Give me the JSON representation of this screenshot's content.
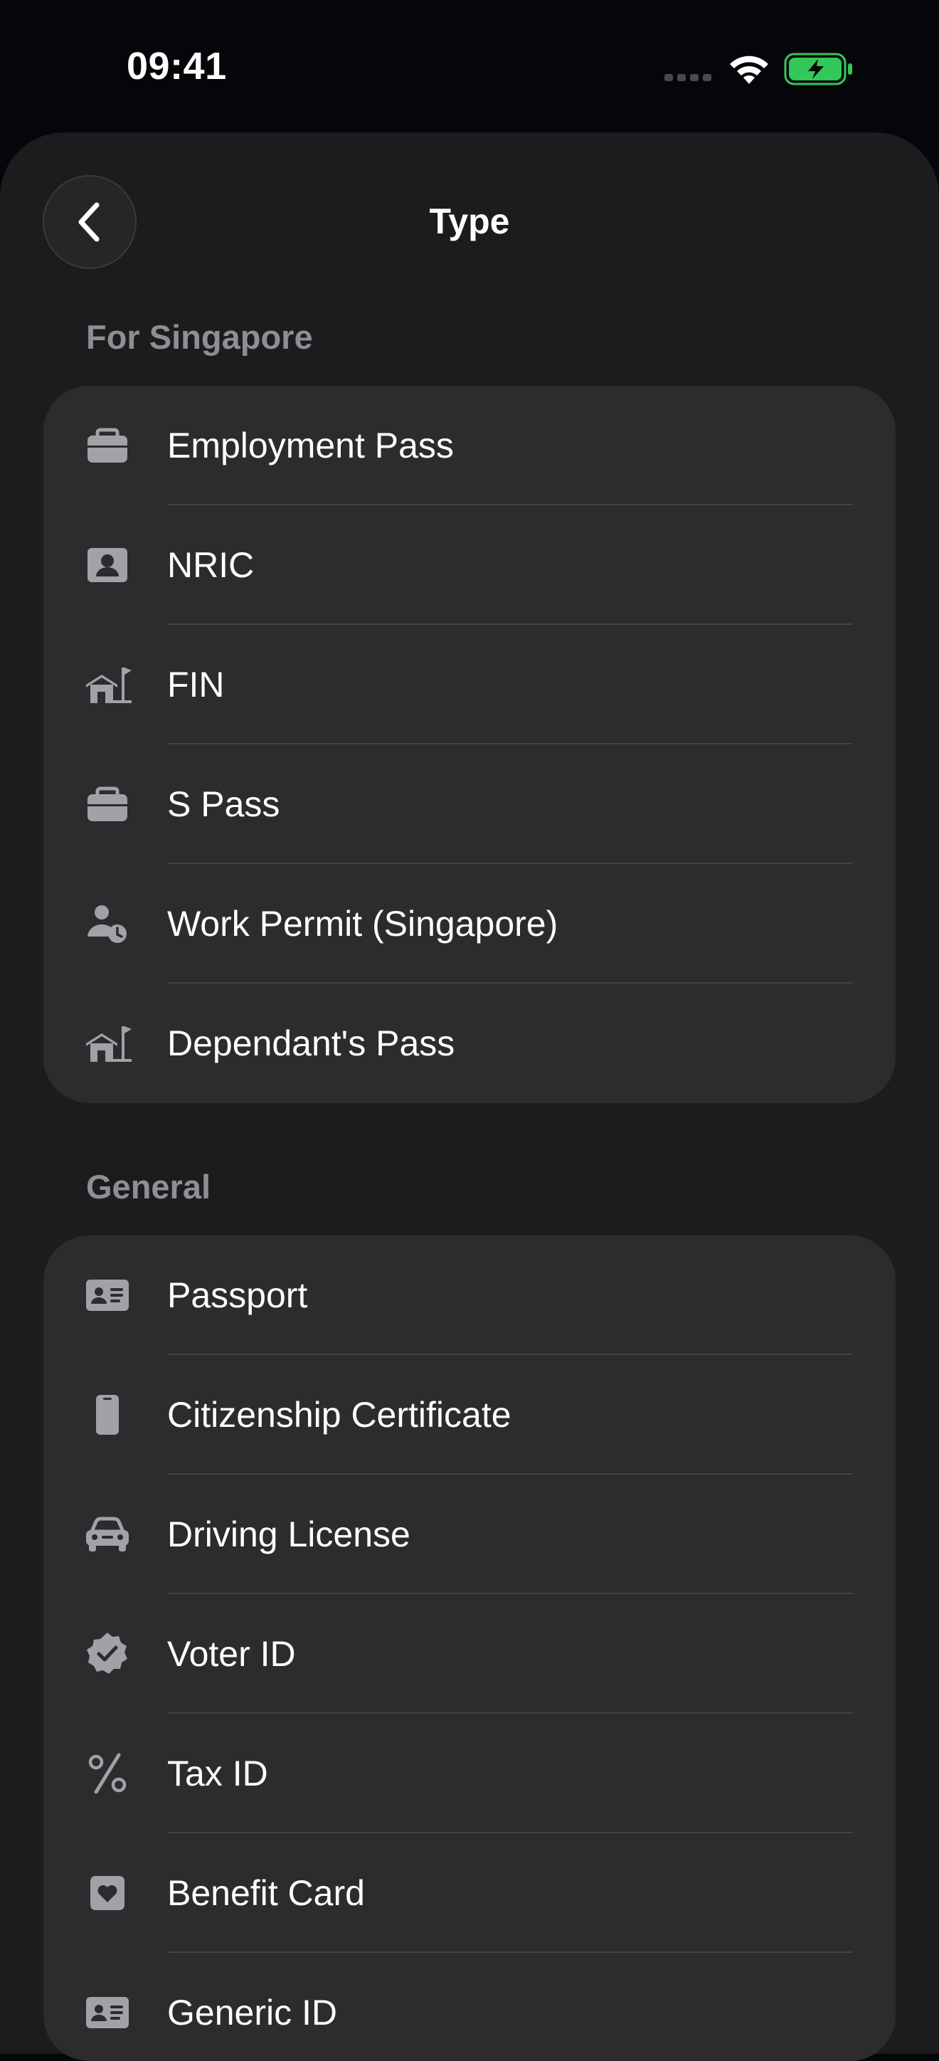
{
  "status_bar": {
    "time": "09:41",
    "battery_color": "#34c759"
  },
  "nav": {
    "title": "Type",
    "back_icon": "chevron-left-icon"
  },
  "sections": [
    {
      "header": "For Singapore",
      "items": [
        {
          "label": "Employment Pass",
          "icon": "briefcase-icon"
        },
        {
          "label": "NRIC",
          "icon": "person-card-icon"
        },
        {
          "label": "FIN",
          "icon": "house-flag-icon"
        },
        {
          "label": "S Pass",
          "icon": "briefcase-icon"
        },
        {
          "label": "Work Permit (Singapore)",
          "icon": "person-clock-icon"
        },
        {
          "label": "Dependant's Pass",
          "icon": "house-flag-icon"
        }
      ]
    },
    {
      "header": "General",
      "items": [
        {
          "label": "Passport",
          "icon": "id-card-icon"
        },
        {
          "label": "Citizenship Certificate",
          "icon": "document-icon"
        },
        {
          "label": "Driving License",
          "icon": "car-icon"
        },
        {
          "label": "Voter ID",
          "icon": "checkmark-seal-icon"
        },
        {
          "label": "Tax ID",
          "icon": "percent-icon"
        },
        {
          "label": "Benefit Card",
          "icon": "heart-square-icon"
        },
        {
          "label": "Generic ID",
          "icon": "id-card-icon"
        }
      ]
    }
  ]
}
